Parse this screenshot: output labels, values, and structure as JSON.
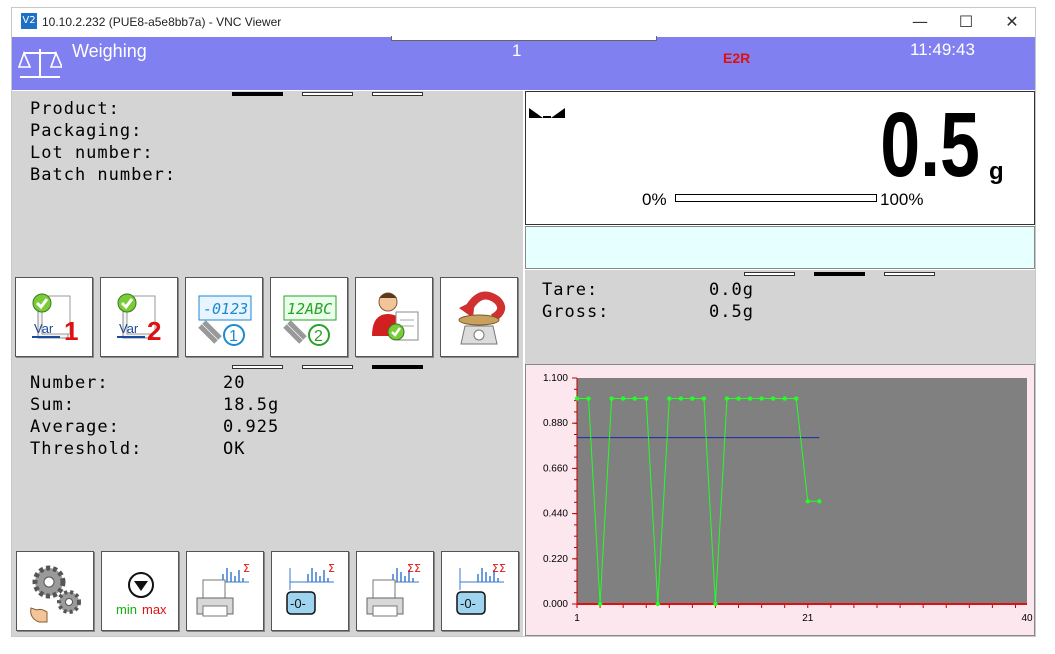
{
  "window": {
    "title": "10.10.2.232 (PUE8-a5e8bb7a) - VNC Viewer",
    "logo": "V2",
    "minimize": "—",
    "maximize": "☐",
    "close": "✕"
  },
  "header": {
    "title": "Weighing",
    "number": "1",
    "mode": "E2R",
    "time": "11:49:43"
  },
  "product_info": {
    "product_label": "Product:",
    "packaging_label": "Packaging:",
    "lot_label": "Lot number:",
    "batch_label": "Batch number:"
  },
  "display": {
    "value": "0.5",
    "unit": "g",
    "bar_min": "0%",
    "bar_max": "100%",
    "bar_fill_fraction": 0.0
  },
  "tare_gross": {
    "tare_label": "Tare:",
    "tare_value": "0.0g",
    "gross_label": "Gross:",
    "gross_value": "0.5g"
  },
  "statistics": {
    "number_label": "Number:",
    "number_value": "20",
    "sum_label": "Sum:",
    "sum_value": "18.5g",
    "average_label": "Average:",
    "average_value": "0.925",
    "threshold_label": "Threshold:",
    "threshold_value": "OK"
  },
  "buttons_row1": [
    {
      "name": "var-1-button",
      "icon": "var-1-icon",
      "text": "Var",
      "badge": "1"
    },
    {
      "name": "var-2-button",
      "icon": "var-2-icon",
      "text": "Var",
      "badge": "2"
    },
    {
      "name": "numeric-code-1-button",
      "icon": "numeric-code-icon",
      "text": "-0123",
      "badge": "1"
    },
    {
      "name": "alpha-code-2-button",
      "icon": "alphanumeric-code-icon",
      "text": "12ABC",
      "badge": "2"
    },
    {
      "name": "operator-button",
      "icon": "operator-icon"
    },
    {
      "name": "return-scale-button",
      "icon": "return-scale-icon"
    }
  ],
  "buttons_row2": [
    {
      "name": "settings-button",
      "icon": "gears-icon"
    },
    {
      "name": "min-max-button",
      "icon": "min-max-icon",
      "min": "min",
      "max": "max"
    },
    {
      "name": "print-sum-button",
      "icon": "print-sum-icon",
      "sigma": "Σ"
    },
    {
      "name": "zero-sum-button",
      "icon": "zero-sum-icon",
      "sigma": "Σ",
      "zero": "-0-"
    },
    {
      "name": "print-total-sum-button",
      "icon": "print-total-sum-icon",
      "sigma": "ΣΣ"
    },
    {
      "name": "zero-total-sum-button",
      "icon": "zero-total-sum-icon",
      "sigma": "ΣΣ",
      "zero": "-0-"
    }
  ],
  "colors": {
    "header_band": "#8080f0",
    "panel_grey": "#d4d4d4",
    "chart_bg": "#808080",
    "chart_outer": "#fde7ee",
    "series_line": "#22ff22",
    "threshold_line": "#1a2aa0",
    "baseline": "#e01010"
  },
  "chart_data": {
    "type": "line",
    "title": "",
    "xlabel": "",
    "ylabel": "",
    "xlim": [
      1,
      40
    ],
    "ylim": [
      0,
      1.1
    ],
    "x_ticks": [
      "1",
      "21",
      "40"
    ],
    "y_ticks": [
      "1.100",
      "0.880",
      "0.660",
      "0.440",
      "0.220",
      "0.000"
    ],
    "x": [
      1,
      2,
      3,
      4,
      5,
      6,
      7,
      8,
      9,
      10,
      11,
      12,
      13,
      14,
      15,
      16,
      17,
      18,
      19,
      20,
      21,
      22
    ],
    "series": [
      {
        "values": [
          1.0,
          1.0,
          0.0,
          1.0,
          1.0,
          1.0,
          1.0,
          0.0,
          1.0,
          1.0,
          1.0,
          1.0,
          0.0,
          1.0,
          1.0,
          1.0,
          1.0,
          1.0,
          1.0,
          1.0,
          0.5,
          0.5
        ]
      }
    ],
    "threshold": {
      "value": 0.81,
      "x_from": 1,
      "x_to": 22
    },
    "baseline": 0.0,
    "grid": false
  }
}
